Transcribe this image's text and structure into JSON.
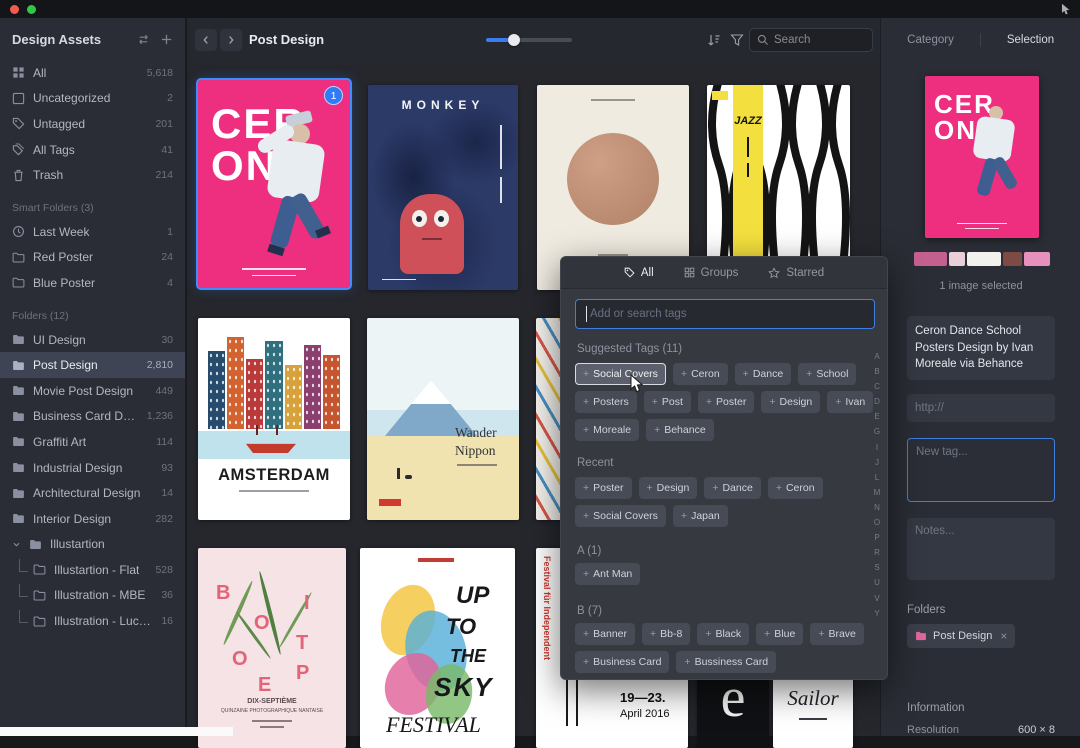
{
  "colors": {
    "accent_blue": "#3b7cf0",
    "selection_blue": "#3f8cff",
    "ceron_pink": "#ee2f7f"
  },
  "sidebar": {
    "title": "Design Assets",
    "library": [
      {
        "icon": "grid-icon",
        "label": "All",
        "count": "5,618"
      },
      {
        "icon": "box-icon",
        "label": "Uncategorized",
        "count": "2"
      },
      {
        "icon": "tag-icon",
        "label": "Untagged",
        "count": "201"
      },
      {
        "icon": "tags-icon",
        "label": "All Tags",
        "count": "41"
      },
      {
        "icon": "trash-icon",
        "label": "Trash",
        "count": "214"
      }
    ],
    "smart_header": "Smart Folders (3)",
    "smart": [
      {
        "icon": "clock-icon",
        "label": "Last Week",
        "count": "1"
      },
      {
        "icon": "smart-folder-icon",
        "label": "Red Poster",
        "count": "24"
      },
      {
        "icon": "smart-folder-icon",
        "label": "Blue Poster",
        "count": "4"
      }
    ],
    "folders_header": "Folders (12)",
    "folders": [
      {
        "label": "UI Design",
        "count": "30"
      },
      {
        "label": "Post Design",
        "count": "2,810",
        "selected": true
      },
      {
        "label": "Movie Post Design",
        "count": "449"
      },
      {
        "label": "Business Card Design",
        "count": "1,236"
      },
      {
        "label": "Graffiti Art",
        "count": "114"
      },
      {
        "label": "Industrial Design",
        "count": "93"
      },
      {
        "label": "Architectural Design",
        "count": "14"
      },
      {
        "label": "Interior Design",
        "count": "282"
      },
      {
        "label": "Illustartion",
        "count": ""
      },
      {
        "label": "Illustartion - Flat",
        "count": "528",
        "child": true
      },
      {
        "label": "Illustration - MBE",
        "count": "36",
        "child": true
      },
      {
        "label": "Illustration - Luca...",
        "count": "16",
        "child": true
      }
    ]
  },
  "toolbar": {
    "title": "Post Design",
    "search_placeholder": "Search"
  },
  "panel": {
    "tab_category": "Category",
    "tab_selection": "Selection",
    "selected_text": "1 image selected",
    "description": "Ceron Dance School Posters Design by Ivan Moreale via Behance",
    "url_placeholder": "http://",
    "tag_placeholder": "New tag...",
    "notes_placeholder": "Notes...",
    "folders_header": "Folders",
    "folder_chip": "Post Design",
    "chip_close": "×",
    "information_header": "Information",
    "resolution_label": "Resolution",
    "resolution_value": "600 × 8",
    "swatches": [
      "#c4608f",
      "#e8cfd8",
      "#f3f1ec",
      "#7d4b43",
      "#e690bd"
    ]
  },
  "grid": {
    "badge": "1",
    "ceron": {
      "line1": "CER",
      "line2": "ON"
    },
    "monkey": {
      "title": "MONKEY"
    },
    "jazz": {
      "title": "JAZZ"
    },
    "amsterdam": {
      "title": "AMSTERDAM"
    },
    "nippon": {
      "line1": "Wander",
      "line2": "Nippon"
    },
    "biotope": {
      "letters": [
        "B",
        "I",
        "O",
        "T",
        "O",
        "P",
        "E"
      ],
      "footer1": "DIX-SEPTIÈME",
      "footer2": "QUINZAINE PHOTOGRAPHIQUE NANTAISE"
    },
    "sky": {
      "lines": [
        "UP",
        "TO",
        "THE",
        "SKY"
      ],
      "festival": "FESTIVAL"
    },
    "april": {
      "side_text": "Festival für Independent",
      "dates": "19—23.",
      "year": "April 2016"
    },
    "eposter": {
      "letter": "e"
    },
    "sailor": {
      "title": "Sailor"
    }
  },
  "popup": {
    "tabs": [
      {
        "icon": "tag-icon",
        "label": "All",
        "active": true
      },
      {
        "icon": "groups-icon",
        "label": "Groups"
      },
      {
        "icon": "star-icon",
        "label": "Starred"
      }
    ],
    "input_placeholder": "Add or search tags",
    "plus": "+",
    "suggested_header": "Suggested Tags (11)",
    "suggested": [
      "Social Covers",
      "Ceron",
      "Dance",
      "School",
      "Posters",
      "Post",
      "Poster",
      "Design",
      "Ivan",
      "Moreale",
      "Behance"
    ],
    "recent_header": "Recent",
    "recent": [
      "Poster",
      "Design",
      "Dance",
      "Ceron",
      "Social Covers",
      "Japan"
    ],
    "group_a_header": "A (1)",
    "group_a": [
      "Ant Man"
    ],
    "group_b_header": "B (7)",
    "group_b": [
      "Banner",
      "Bb-8",
      "Black",
      "Blue",
      "Brave",
      "Business Card",
      "Bussiness Card"
    ],
    "index": [
      "A",
      "B",
      "C",
      "D",
      "E",
      "G",
      "I",
      "J",
      "L",
      "M",
      "N",
      "O",
      "P",
      "R",
      "S",
      "U",
      "V",
      "Y"
    ]
  }
}
